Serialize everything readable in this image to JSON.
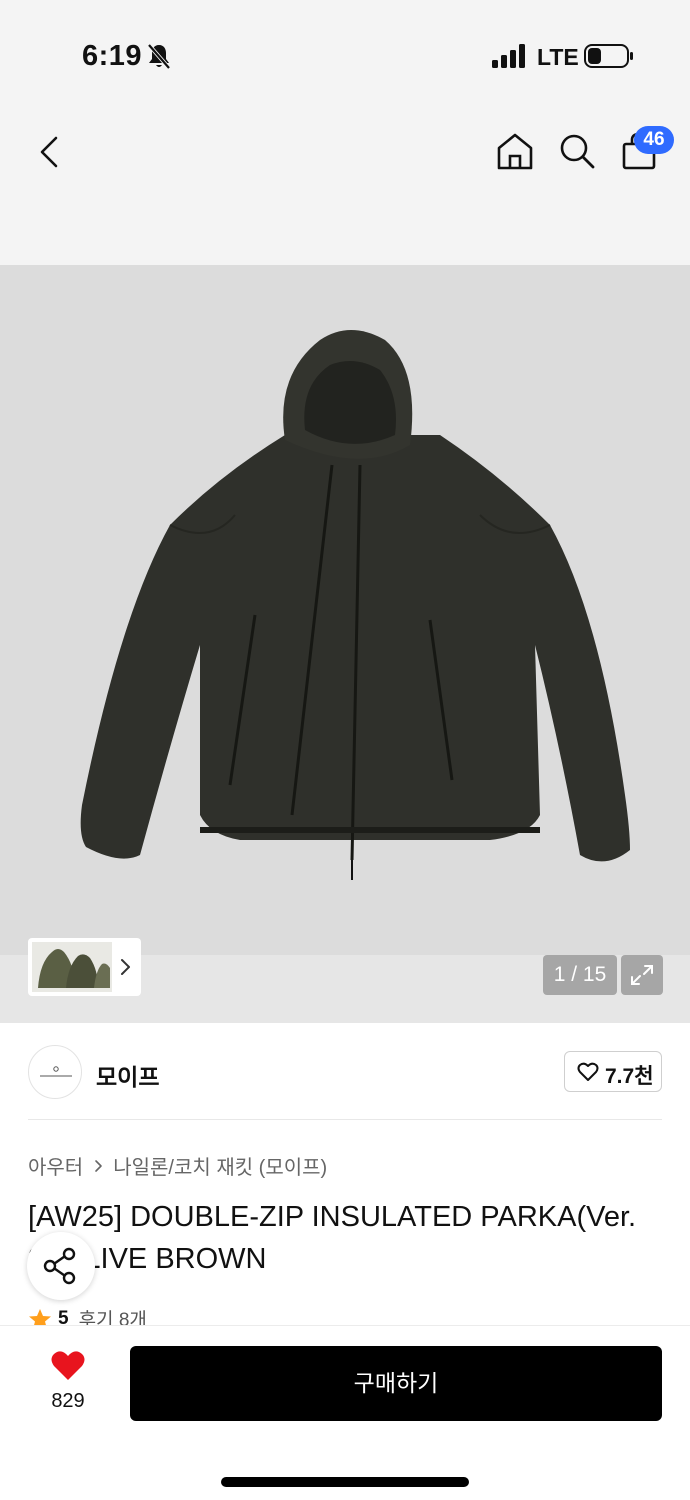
{
  "status_bar": {
    "time": "6:19",
    "network": "LTE",
    "icons": [
      "bell-off-icon",
      "signal-icon",
      "battery-icon"
    ]
  },
  "nav": {
    "back_icon": "chevron-left-icon",
    "home_icon": "home-icon",
    "search_icon": "search-icon",
    "cart_icon": "shopping-bag-icon",
    "cart_count": "46",
    "badge_color": "#2f6bff"
  },
  "gallery": {
    "counter": "1 / 15",
    "expand_icon": "expand-icon",
    "thumb_arrow_icon": "chevron-right-icon"
  },
  "brand": {
    "name": "모이프",
    "likes": "7.7천",
    "like_icon": "heart-outline-icon"
  },
  "breadcrumb": {
    "parent": "아우터",
    "child": "나일론/코치 재킷 (모이프)"
  },
  "product": {
    "title": "[AW25] DOUBLE-ZIP INSULATED PARKA(Ver. 2) OLIVE BROWN",
    "rating": "5",
    "review_label": "후기 8개",
    "star_color": "#ff9f1c"
  },
  "bottom_bar": {
    "like_count": "829",
    "buy_label": "구매하기",
    "heart_color": "#e8141e"
  }
}
